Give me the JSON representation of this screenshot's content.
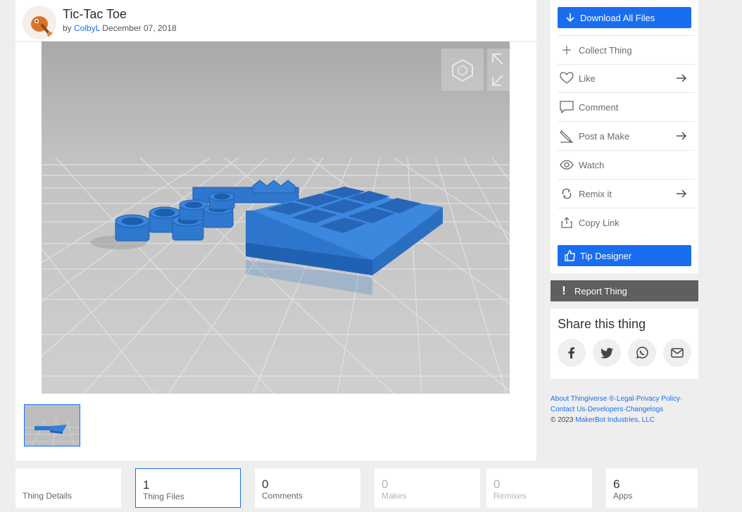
{
  "thing": {
    "title": "Tic-Tac Toe",
    "by_prefix": "by",
    "author": "ColbyL",
    "date": "December 07, 2018"
  },
  "sidebar": {
    "download_label": "Download All Files",
    "actions": [
      {
        "label": "Collect Thing",
        "icon": "plus-icon"
      },
      {
        "label": "Like",
        "icon": "heart-icon"
      },
      {
        "label": "Comment",
        "icon": "comment-icon"
      },
      {
        "label": "Post a Make",
        "icon": "pen-icon"
      },
      {
        "label": "Watch",
        "icon": "eye-icon"
      },
      {
        "label": "Remix it",
        "icon": "remix-icon"
      },
      {
        "label": "Copy Link",
        "icon": "share-icon"
      }
    ],
    "tip_label": "Tip Designer"
  },
  "report_label": "Report Thing",
  "share": {
    "title": "Share this thing",
    "networks": [
      "facebook-icon",
      "twitter-icon",
      "whatsapp-icon",
      "email-icon"
    ]
  },
  "footer": {
    "links_line1": [
      "About Thingiverse ®",
      "Legal",
      "Privacy Policy"
    ],
    "links_line2": [
      "Contact Us",
      "Developers",
      "Changelogs"
    ],
    "copyright": "©  2023",
    "company": "MakerBot Industries, LLC"
  },
  "tabs": [
    {
      "count": "",
      "label": "Thing Details"
    },
    {
      "count": "1",
      "label": "Thing Files"
    },
    {
      "count": "0",
      "label": "Comments"
    },
    {
      "count": "0",
      "label": "Makes"
    },
    {
      "count": "0",
      "label": "Remixes"
    },
    {
      "count": "6",
      "label": "Apps"
    }
  ],
  "colors": {
    "accent": "#196ef0",
    "report_bg": "#5f5f5f",
    "model": "#2f78cf",
    "background": "#eeeeee"
  }
}
